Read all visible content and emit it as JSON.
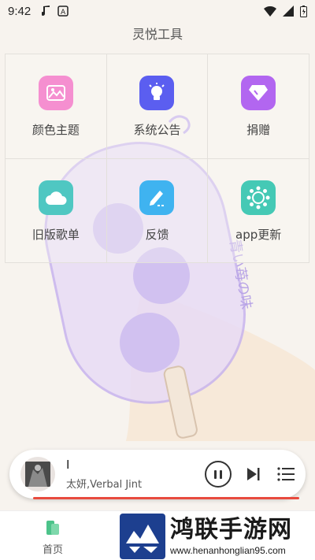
{
  "status_bar": {
    "time": "9:42"
  },
  "header": {
    "title": "灵悦工具"
  },
  "tiles": [
    {
      "label": "颜色主题",
      "icon": "image-icon",
      "color": "#f58fd0"
    },
    {
      "label": "系统公告",
      "icon": "lightbulb-icon",
      "color": "#5b5ef0"
    },
    {
      "label": "捐赠",
      "icon": "diamond-icon",
      "color": "#b266f0"
    },
    {
      "label": "旧版歌单",
      "icon": "cloud-icon",
      "color": "#4fc7c2"
    },
    {
      "label": "反馈",
      "icon": "edit-icon",
      "color": "#3fb3f0"
    },
    {
      "label": "app更新",
      "icon": "settings-icon",
      "color": "#45c9b5"
    }
  ],
  "player": {
    "title": "I",
    "artist": "太妍,Verbal Jint",
    "progress_color": "#e84a3e"
  },
  "bottom_nav": {
    "home_label": "首页",
    "home_color": "#4cc38a"
  },
  "watermark": {
    "name": "鸿联手游网",
    "url": "www.henanhonglian95.com"
  }
}
